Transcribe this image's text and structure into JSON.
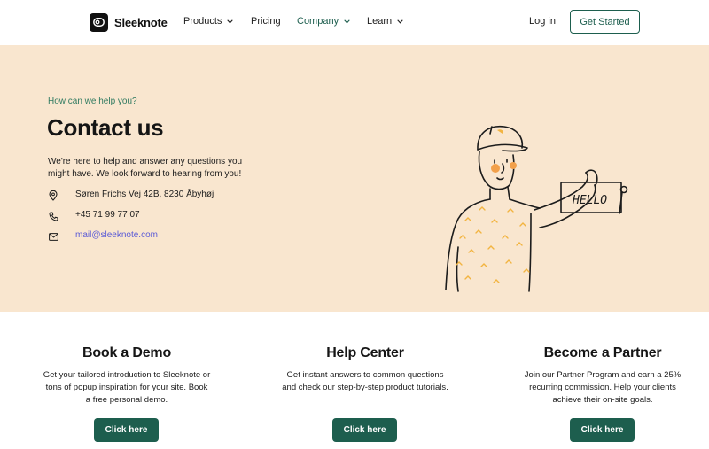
{
  "brand": {
    "name": "Sleeknote",
    "logo_icon": "sleeknote-logo-icon"
  },
  "nav": {
    "items": [
      {
        "label": "Products",
        "has_dropdown": true
      },
      {
        "label": "Pricing",
        "has_dropdown": false
      },
      {
        "label": "Company",
        "has_dropdown": true,
        "active": true
      },
      {
        "label": "Learn",
        "has_dropdown": true
      }
    ],
    "login_label": "Log in",
    "cta_label": "Get Started"
  },
  "hero": {
    "eyebrow": "How can we help you?",
    "title": "Contact us",
    "intro": "We're here to help and answer any questions you might have. We look forward to hearing from you!",
    "address": "Søren Frichs Vej 42B, 8230 Åbyhøj",
    "phone": "+45 71 99 77 07",
    "email": "mail@sleeknote.com",
    "illustration_sign": "HELLO"
  },
  "cards": [
    {
      "title": "Book a Demo",
      "text": "Get your tailored introduction to Sleeknote or tons of popup inspiration for your site. Book a free personal demo.",
      "button": "Click here"
    },
    {
      "title": "Help Center",
      "text": "Get instant answers to common questions and check our step-by-step product tutorials.",
      "button": "Click here"
    },
    {
      "title": "Become a Partner",
      "text": "Join our Partner Program and earn a 25% recurring commission. Help your clients achieve their on-site goals.",
      "button": "Click here"
    }
  ],
  "colors": {
    "accent": "#1d5e4e",
    "hero_bg": "#f9e6cf",
    "link": "#5a5ad6",
    "illustration_highlight": "#f2b441"
  }
}
